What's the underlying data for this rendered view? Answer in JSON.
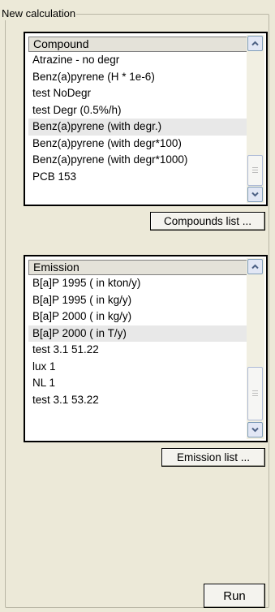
{
  "group": {
    "title": "New calculation"
  },
  "compound_list": {
    "header": "Compound",
    "selected_index": 4,
    "items": [
      "Atrazine - no degr",
      "Benz(a)pyrene (H * 1e-6)",
      "test NoDegr",
      "test Degr (0.5%/h)",
      "Benz(a)pyrene (with degr.)",
      "Benz(a)pyrene (with degr*100)",
      "Benz(a)pyrene (with degr*1000)",
      "PCB 153"
    ]
  },
  "compound_button": {
    "label": "Compounds list ..."
  },
  "emission_list": {
    "header": "Emission",
    "selected_index": 3,
    "items": [
      "B[a]P 1995 ( in kton/y)",
      "B[a]P 1995 ( in kg/y)",
      "B[a]P 2000 ( in kg/y)",
      "B[a]P 2000 ( in T/y)",
      "test 3.1 51.22",
      "lux 1",
      "NL 1",
      "test 3.1 53.22"
    ]
  },
  "emission_button": {
    "label": "Emission list ..."
  },
  "run_button": {
    "label": "Run"
  },
  "icons": {
    "scroll_up": "chevron-up-icon",
    "scroll_down": "chevron-down-icon",
    "thumb_grip": "grip-icon"
  }
}
